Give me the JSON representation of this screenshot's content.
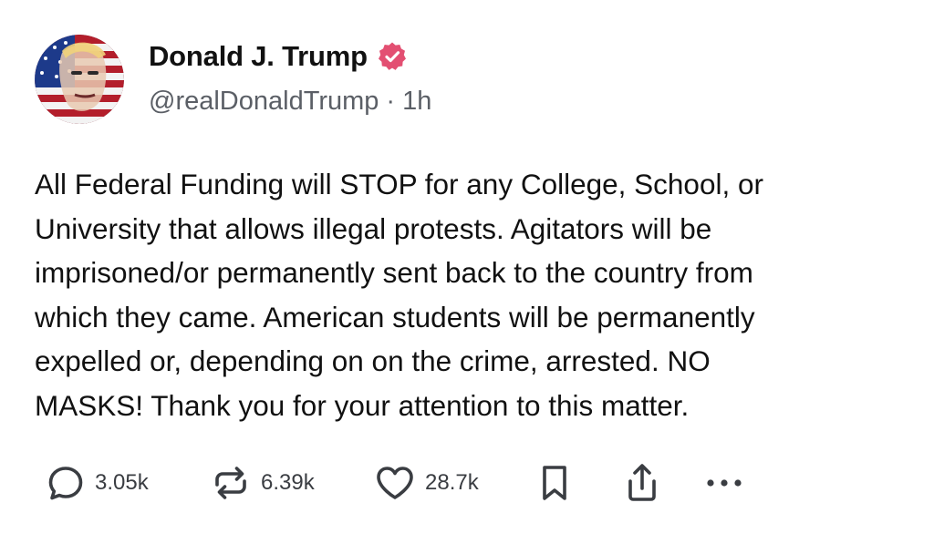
{
  "author": {
    "display_name": "Donald J. Trump",
    "handle": "@realDonaldTrump",
    "separator": "·",
    "time_ago": "1h",
    "verified": true,
    "verified_color": "#e34f72"
  },
  "post": {
    "lines": [
      "All Federal Funding will STOP for any College, School, or",
      "University that allows illegal protests. Agitators will be",
      "imprisoned/or permanently sent back to the country from",
      "which they came. American students will be permanently",
      "expelled or, depending on on the crime, arrested. NO",
      "MASKS! Thank you for your attention to this matter."
    ]
  },
  "actions": {
    "replies": {
      "icon": "reply-icon",
      "count": "3.05k"
    },
    "reposts": {
      "icon": "repost-icon",
      "count": "6.39k"
    },
    "likes": {
      "icon": "heart-icon",
      "count": "28.7k"
    },
    "bookmark": {
      "icon": "bookmark-icon"
    },
    "share": {
      "icon": "share-icon"
    },
    "more": {
      "icon": "more-icon"
    }
  },
  "colors": {
    "text": "#111111",
    "muted": "#5b5f66",
    "icon": "#3a3d42"
  }
}
